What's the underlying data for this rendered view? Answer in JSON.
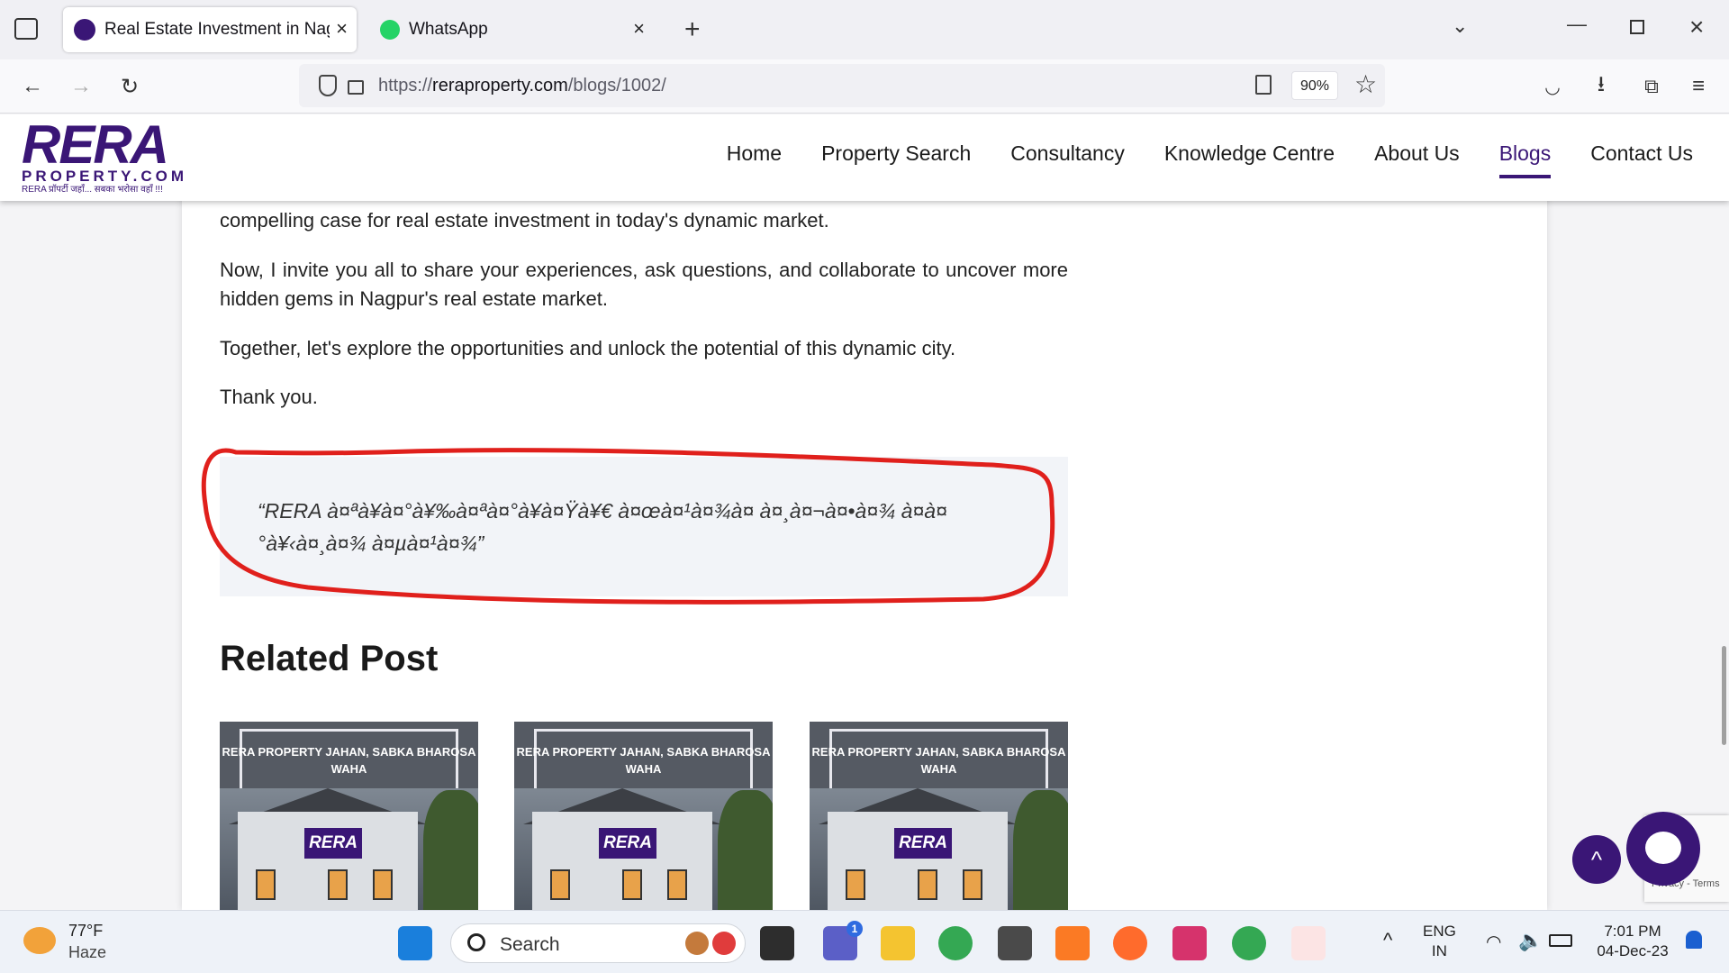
{
  "browser": {
    "tabs": [
      {
        "title": "Real Estate Investment in Nagpur",
        "active": true
      },
      {
        "title": "WhatsApp",
        "active": false
      }
    ],
    "new_tab": "+",
    "url_prefix": "https://",
    "url_domain": "reraproperty.com",
    "url_path": "/blogs/1002/",
    "zoom": "90%"
  },
  "site": {
    "logo_main": "RERA",
    "logo_sub": "PROPERTY.COM",
    "logo_tagline": "RERA प्रॉपर्टी जहाँ... सबका भरोसा वहाँ !!!",
    "menu": [
      "Home",
      "Property Search",
      "Consultancy",
      "Knowledge Centre",
      "About Us",
      "Blogs",
      "Contact Us"
    ],
    "active_menu": "Blogs"
  },
  "article": {
    "p1": "compelling case for real estate investment in today's dynamic market.",
    "p2": "Now, I invite you all to share your experiences, ask questions, and collaborate to uncover more hidden gems in Nagpur's real estate market.",
    "p3": "Together, let's explore the opportunities and unlock the potential of this dynamic city.",
    "p4": "Thank you.",
    "quote": "“RERA à¤ªà¥à¤°à¥‰à¤ªà¤°à¥à¤Ÿà¥€ à¤œà¤¹à¤¾à¤ à¤¸à¤¬à¤•à¤¾ à¤­à¤°à¥‹à¤¸à¤¾ à¤µà¤¹à¤¾”",
    "related_title": "Related Post",
    "card_banner": "RERA PROPERTY JAHAN, SABKA BHAROSA WAHA",
    "card_sign": "RERA"
  },
  "widgets": {
    "scroll_top": "^",
    "recaptcha": "Privacy - Terms"
  },
  "taskbar": {
    "weather_temp": "77°F",
    "weather_desc": "Haze",
    "search_label": "Search",
    "teams_badge": "1",
    "lang_top": "ENG",
    "lang_bottom": "IN",
    "time": "7:01 PM",
    "date": "04-Dec-23"
  },
  "colors": {
    "brand": "#3a1676",
    "annotation": "#e0201c"
  }
}
